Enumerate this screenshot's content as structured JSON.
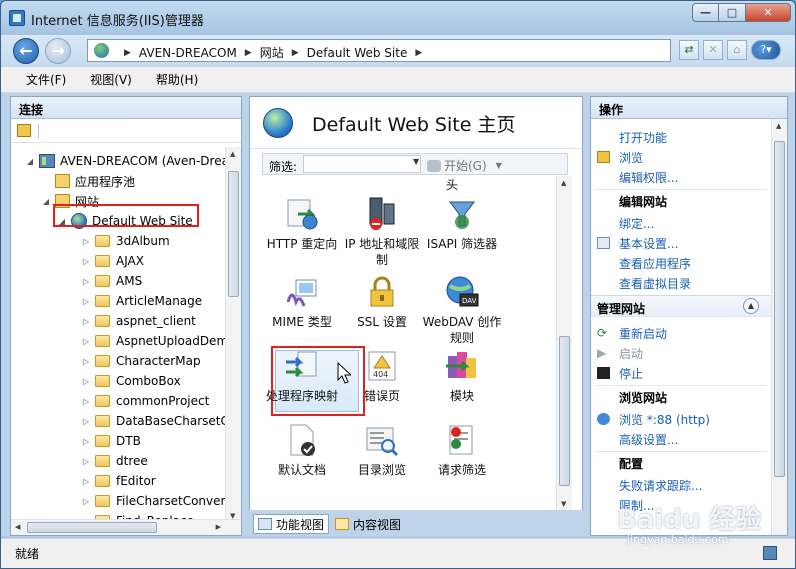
{
  "window": {
    "title": "Internet 信息服务(IIS)管理器"
  },
  "address": {
    "crumbs": [
      "AVEN-DREACOM",
      "网站",
      "Default Web Site"
    ]
  },
  "menu": [
    "文件(F)",
    "视图(V)",
    "帮助(H)"
  ],
  "connections": {
    "header": "连接",
    "tree": [
      {
        "label": "AVEN-DREACOM (Aven-Drea",
        "icon": "server-icon",
        "level": 0,
        "expand": "◢"
      },
      {
        "label": "应用程序池",
        "icon": "app-pool-icon",
        "level": 1,
        "expand": ""
      },
      {
        "label": "网站",
        "icon": "sites-folder-icon",
        "level": 1,
        "expand": "◢"
      },
      {
        "label": "Default Web Site",
        "icon": "globe-icon",
        "level": 2,
        "expand": "◢",
        "selected": true
      },
      {
        "label": "3dAlbum",
        "icon": "folder-icon",
        "level": 3,
        "expand": "▷"
      },
      {
        "label": "AJAX",
        "icon": "folder-icon",
        "level": 3,
        "expand": "▷"
      },
      {
        "label": "AMS",
        "icon": "folder-icon",
        "level": 3,
        "expand": "▷"
      },
      {
        "label": "ArticleManage",
        "icon": "folder-icon",
        "level": 3,
        "expand": "▷"
      },
      {
        "label": "aspnet_client",
        "icon": "folder-icon",
        "level": 3,
        "expand": "▷"
      },
      {
        "label": "AspnetUploadDem",
        "icon": "folder-icon",
        "level": 3,
        "expand": "▷"
      },
      {
        "label": "CharacterMap",
        "icon": "folder-icon",
        "level": 3,
        "expand": "▷"
      },
      {
        "label": "ComboBox",
        "icon": "folder-icon",
        "level": 3,
        "expand": "▷"
      },
      {
        "label": "commonProject",
        "icon": "folder-icon",
        "level": 3,
        "expand": "▷"
      },
      {
        "label": "DataBaseCharsetCo",
        "icon": "folder-icon",
        "level": 3,
        "expand": "▷"
      },
      {
        "label": "DTB",
        "icon": "folder-icon",
        "level": 3,
        "expand": "▷"
      },
      {
        "label": "dtree",
        "icon": "folder-icon",
        "level": 3,
        "expand": "▷"
      },
      {
        "label": "fEditor",
        "icon": "folder-icon",
        "level": 3,
        "expand": "▷"
      },
      {
        "label": "FileCharsetConvert",
        "icon": "folder-icon",
        "level": 3,
        "expand": "▷"
      },
      {
        "label": "Find_Replace",
        "icon": "folder-icon",
        "level": 3,
        "expand": "▷"
      }
    ]
  },
  "center": {
    "title": "Default Web Site 主页",
    "filter": {
      "label": "筛选:",
      "start": "开始(G)"
    },
    "cut_label": "头",
    "features": [
      {
        "label": "HTTP 重定向",
        "icon": "http-redirect-icon"
      },
      {
        "label": "IP 地址和域限制",
        "icon": "ip-restrictions-icon"
      },
      {
        "label": "ISAPI 筛选器",
        "icon": "isapi-filters-icon"
      },
      {
        "label": "MIME 类型",
        "icon": "mime-types-icon",
        "selected": true
      },
      {
        "label": "SSL 设置",
        "icon": "ssl-lock-icon"
      },
      {
        "label": "WebDAV 创作规则",
        "icon": "webdav-icon"
      },
      {
        "label": "处理程序映射",
        "icon": "handler-mappings-icon"
      },
      {
        "label": "错误页",
        "icon": "error-pages-icon"
      },
      {
        "label": "模块",
        "icon": "modules-icon"
      },
      {
        "label": "默认文档",
        "icon": "default-document-icon"
      },
      {
        "label": "目录浏览",
        "icon": "directory-browsing-icon"
      },
      {
        "label": "请求筛选",
        "icon": "request-filtering-icon"
      }
    ],
    "views": {
      "features": "功能视图",
      "content": "内容视图"
    }
  },
  "actions": {
    "header": "操作",
    "items": [
      {
        "type": "link",
        "label": "打开功能",
        "icon": ""
      },
      {
        "type": "link",
        "label": "浏览",
        "icon": "explore-icon"
      },
      {
        "type": "link",
        "label": "编辑权限...",
        "icon": ""
      },
      {
        "type": "sub",
        "label": "编辑网站"
      },
      {
        "type": "link",
        "label": "绑定...",
        "icon": ""
      },
      {
        "type": "link",
        "label": "基本设置...",
        "icon": "settings-icon"
      },
      {
        "type": "link",
        "label": "查看应用程序",
        "icon": ""
      },
      {
        "type": "link",
        "label": "查看虚拟目录",
        "icon": ""
      },
      {
        "type": "section",
        "label": "管理网站"
      },
      {
        "type": "link",
        "label": "重新启动",
        "icon": "restart-icon"
      },
      {
        "type": "disabled",
        "label": "启动",
        "icon": "start-icon"
      },
      {
        "type": "link",
        "label": "停止",
        "icon": "stop-icon"
      },
      {
        "type": "sub",
        "label": "浏览网站"
      },
      {
        "type": "link",
        "label": "浏览 *:88 (http)",
        "icon": "browse-icon"
      },
      {
        "type": "link",
        "label": "高级设置...",
        "icon": ""
      },
      {
        "type": "sub",
        "label": "配置"
      },
      {
        "type": "link",
        "label": "失败请求跟踪...",
        "icon": ""
      },
      {
        "type": "link",
        "label": "限制...",
        "icon": ""
      }
    ]
  },
  "status": {
    "text": "就绪"
  },
  "watermark": {
    "brand": "Baidu 经验",
    "url": "jingyan.baidu.com"
  },
  "colors": {
    "selection_red": "#e01f1f",
    "link_blue": "#1a5fb4"
  }
}
